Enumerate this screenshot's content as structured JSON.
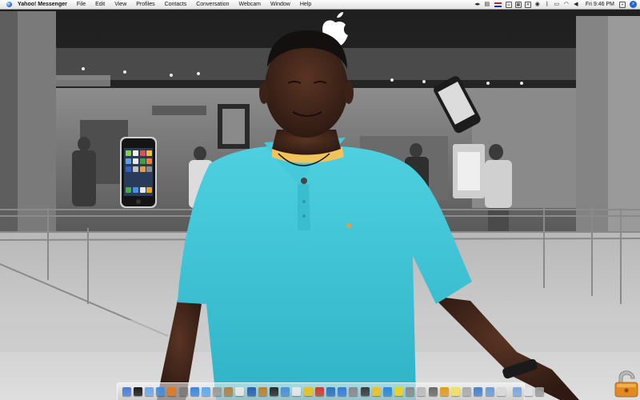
{
  "menubar": {
    "apple_icon": "apple-menu-icon",
    "app_name": "Yahoo! Messenger",
    "items": [
      {
        "label": "File"
      },
      {
        "label": "Edit"
      },
      {
        "label": "View"
      },
      {
        "label": "Profiles"
      },
      {
        "label": "Contacts"
      },
      {
        "label": "Conversation"
      },
      {
        "label": "Webcam"
      },
      {
        "label": "Window"
      },
      {
        "label": "Help"
      }
    ],
    "status_icons": [
      "back-forward-icon",
      "volume-icon",
      "flag-icon",
      "messenger-icon",
      "document-icon",
      "cross-icon",
      "globe-icon",
      "bluetooth-icon",
      "display-icon",
      "wifi-icon",
      "speaker-icon"
    ],
    "clock": "Fri 9:46 PM",
    "spotlight_icon": "spotlight-icon"
  },
  "desktop": {
    "wallpaper": "Photo of a man in a turquoise polo shirt in front of an Apple Store"
  },
  "dock": {
    "icons": [
      {
        "name": "finder-icon",
        "color": "#4a7fd6"
      },
      {
        "name": "dashboard-icon",
        "color": "#1a1a1a"
      },
      {
        "name": "mail-icon",
        "color": "#6da7e8"
      },
      {
        "name": "safari-icon",
        "color": "#3f8fe0"
      },
      {
        "name": "firefox-icon",
        "color": "#e07a22"
      },
      {
        "name": "camino-icon",
        "color": "#7a7a7a"
      },
      {
        "name": "itunes-icon",
        "color": "#3a86dd"
      },
      {
        "name": "iphoto-icon",
        "color": "#5fa8e8"
      },
      {
        "name": "preview-icon",
        "color": "#9a9a9a"
      },
      {
        "name": "address-book-icon",
        "color": "#b0804a"
      },
      {
        "name": "ical-icon",
        "color": "#e8e8e8"
      },
      {
        "name": "imovie-icon",
        "color": "#2a60b0"
      },
      {
        "name": "garageband-icon",
        "color": "#c08030"
      },
      {
        "name": "idvd-icon",
        "color": "#2a2a2a"
      },
      {
        "name": "iweb-icon",
        "color": "#4a90d8"
      },
      {
        "name": "textedit-icon",
        "color": "#e8e8e8"
      },
      {
        "name": "adium-icon",
        "color": "#e8c020"
      },
      {
        "name": "pages-icon",
        "color": "#c84030"
      },
      {
        "name": "keynote-icon",
        "color": "#3070c0"
      },
      {
        "name": "quicktime-icon",
        "color": "#3a7ad8"
      },
      {
        "name": "calculator-icon",
        "color": "#8a8a8a"
      },
      {
        "name": "photo-booth-icon",
        "color": "#3a3a3a"
      },
      {
        "name": "smiley-icon",
        "color": "#f0c020"
      },
      {
        "name": "network-icon",
        "color": "#2a8ad8"
      },
      {
        "name": "duck-icon",
        "color": "#f0d020"
      },
      {
        "name": "system-preferences-icon",
        "color": "#8a8a8a"
      },
      {
        "name": "terminal-icon",
        "color": "#bababa"
      },
      {
        "name": "automator-icon",
        "color": "#6a6a6a"
      },
      {
        "name": "toast-icon",
        "color": "#e09a20"
      },
      {
        "name": "stickies-icon",
        "color": "#f0e060"
      },
      {
        "name": "magnifier-icon",
        "color": "#aaaaaa"
      },
      {
        "name": "exposé-icon",
        "color": "#4a80c8"
      },
      {
        "name": "spaces-icon",
        "color": "#6a9ad8"
      },
      {
        "name": "window-icon",
        "color": "#d8d8d8"
      },
      {
        "name": "folder-icon",
        "color": "#7aa6e0"
      },
      {
        "name": "documents-icon",
        "color": "#e0e0e0"
      },
      {
        "name": "trash-icon",
        "color": "#9a9a9a"
      }
    ]
  },
  "lock_widget": {
    "icon": "padlock-icon"
  }
}
